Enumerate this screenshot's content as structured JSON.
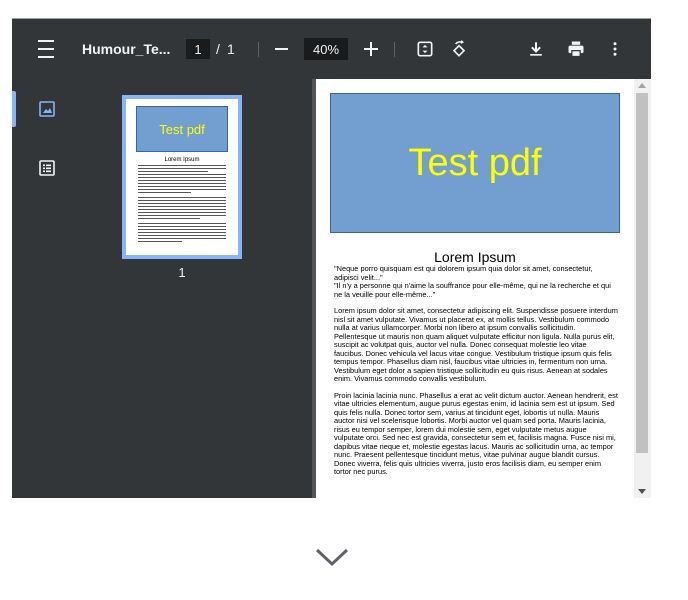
{
  "toolbar": {
    "title": "Humour_Te...",
    "page_current": "1",
    "page_separator": "/",
    "page_total": "1",
    "zoom_level": "40%",
    "icons": [
      "menu-icon",
      "zoom-out-icon",
      "zoom-in-icon",
      "fit-page-icon",
      "rotate-icon",
      "download-icon",
      "print-icon",
      "more-vert-icon"
    ]
  },
  "sidebar": {
    "tabs": [
      "thumbnail-view-icon",
      "outline-view-icon"
    ],
    "thumbnail": {
      "banner_text": "Test pdf",
      "heading": "Lorem Ipsum",
      "page_number": "1"
    }
  },
  "document": {
    "banner_text": "Test pdf",
    "banner_color": "#729fcf",
    "banner_text_color": "#ffff00",
    "heading": "Lorem Ipsum",
    "paragraphs": [
      "\"Neque porro quisquam est qui dolorem ipsum quia dolor sit amet, consectetur, adipisci velit...\"\n\"Il n'y a personne qui n'aime la souffrance pour elle-même, qui ne la recherche et qui ne la veuille pour elle-même...\"",
      "Lorem ipsum dolor sit amet, consectetur adipiscing elit. Suspendisse posuere interdum nisl sit amet vulputate. Vivamus ut placerat ex, at mollis tellus. Vestibulum commodo nulla at varius ullamcorper. Morbi non libero at ipsum convallis sollicitudin. Pellentesque ut mauris non quam aliquet vulputate efficitur non ligula. Nulla purus elit, suscipit ac volutpat quis, auctor vel nulla. Donec consequat molestie leo vitae faucibus. Donec vehicula vel lacus vitae congue. Vestibulum tristique ipsum quis felis tempus tempor. Phasellus diam nisl, faucibus vitae ultricies in, fermentum non urna. Vestibulum eget dolor a sapien tristique sollicitudin eu quis risus. Aenean at sodales enim. Vivamus commodo convallis vestibulum.",
      "Proin lacinia lacinia nunc. Phasellus a erat ac velit dictum auctor. Aenean hendrerit, est vitae ultricies elementum, augue purus egestas enim, id lacinia sem est ut ipsum. Sed quis felis nulla. Donec tortor sem, varius at tincidunt eget, lobortis ut nulla. Mauris auctor nisi vel scelerisque lobortis. Morbi auctor vel quam sed porta. Mauris lacinia, risus eu tempor semper, lorem dui molestie sem, eget vulputate metus augue vulputate orci. Sed nec est gravida, consectetur sem et, facilisis magna. Fusce nisi mi, dapibus vitae neque et, molestie egestas lacus. Mauris ac sollicitudin urna, ac tempor nunc. Praesent pellentesque tincidunt metus, vitae pulvinar augue blandit cursus. Donec viverra, felis quis ultricies viverra, justo eros facilisis diam, eu semper enim tortor nec purus."
    ]
  },
  "colors": {
    "toolbar_bg": "#323639",
    "viewer_bg": "#525659",
    "accent": "#8ab4f8"
  },
  "footer": {
    "expand_icon": "chevron-down-icon"
  }
}
